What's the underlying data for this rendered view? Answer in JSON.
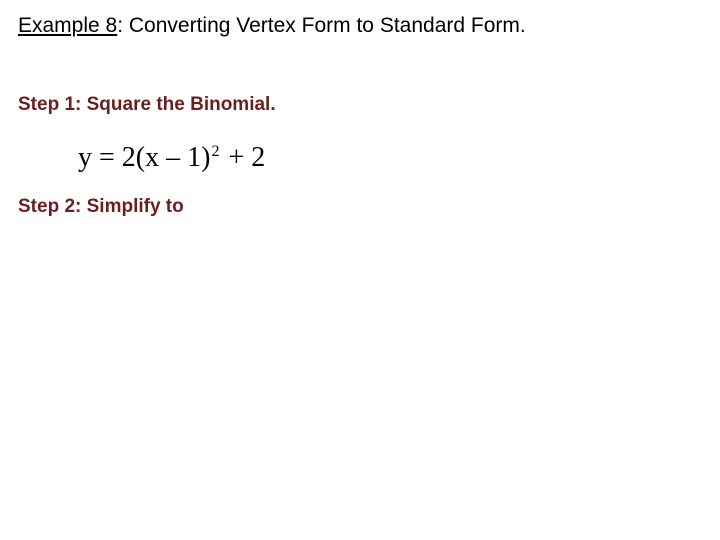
{
  "title_prefix": "Example 8",
  "title_rest": ": Converting Vertex Form to Standard Form.",
  "step1_label": "Step 1:  Square the Binomial.",
  "step2_label": "Step 2:  Simplify to",
  "equation": {
    "lhs": "y = 2(x – 1)",
    "exp": "2",
    "rhs": " + 2"
  }
}
